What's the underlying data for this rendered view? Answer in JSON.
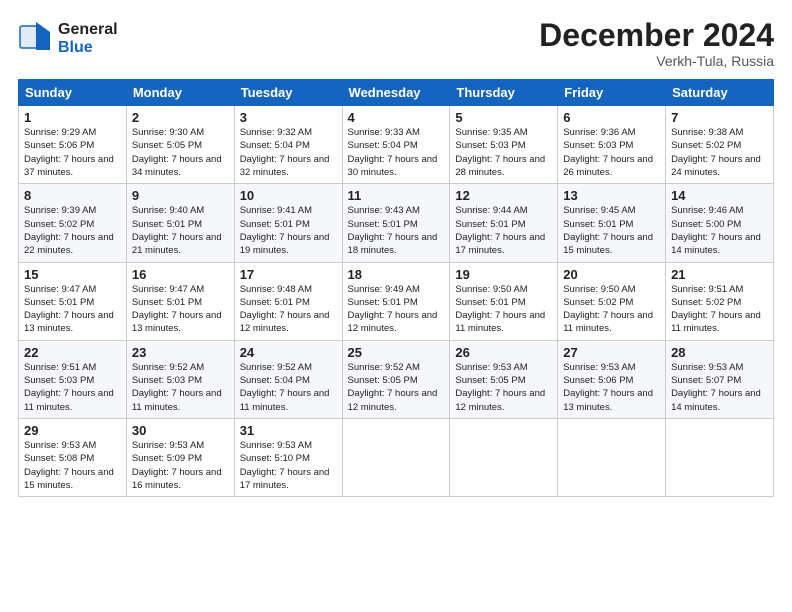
{
  "header": {
    "logo_line1": "General",
    "logo_line2": "Blue",
    "month_title": "December 2024",
    "location": "Verkh-Tula, Russia"
  },
  "days_of_week": [
    "Sunday",
    "Monday",
    "Tuesday",
    "Wednesday",
    "Thursday",
    "Friday",
    "Saturday"
  ],
  "weeks": [
    [
      {
        "day": "1",
        "sunrise": "9:29 AM",
        "sunset": "5:06 PM",
        "daylight": "7 hours and 37 minutes."
      },
      {
        "day": "2",
        "sunrise": "9:30 AM",
        "sunset": "5:05 PM",
        "daylight": "7 hours and 34 minutes."
      },
      {
        "day": "3",
        "sunrise": "9:32 AM",
        "sunset": "5:04 PM",
        "daylight": "7 hours and 32 minutes."
      },
      {
        "day": "4",
        "sunrise": "9:33 AM",
        "sunset": "5:04 PM",
        "daylight": "7 hours and 30 minutes."
      },
      {
        "day": "5",
        "sunrise": "9:35 AM",
        "sunset": "5:03 PM",
        "daylight": "7 hours and 28 minutes."
      },
      {
        "day": "6",
        "sunrise": "9:36 AM",
        "sunset": "5:03 PM",
        "daylight": "7 hours and 26 minutes."
      },
      {
        "day": "7",
        "sunrise": "9:38 AM",
        "sunset": "5:02 PM",
        "daylight": "7 hours and 24 minutes."
      }
    ],
    [
      {
        "day": "8",
        "sunrise": "9:39 AM",
        "sunset": "5:02 PM",
        "daylight": "7 hours and 22 minutes."
      },
      {
        "day": "9",
        "sunrise": "9:40 AM",
        "sunset": "5:01 PM",
        "daylight": "7 hours and 21 minutes."
      },
      {
        "day": "10",
        "sunrise": "9:41 AM",
        "sunset": "5:01 PM",
        "daylight": "7 hours and 19 minutes."
      },
      {
        "day": "11",
        "sunrise": "9:43 AM",
        "sunset": "5:01 PM",
        "daylight": "7 hours and 18 minutes."
      },
      {
        "day": "12",
        "sunrise": "9:44 AM",
        "sunset": "5:01 PM",
        "daylight": "7 hours and 17 minutes."
      },
      {
        "day": "13",
        "sunrise": "9:45 AM",
        "sunset": "5:01 PM",
        "daylight": "7 hours and 15 minutes."
      },
      {
        "day": "14",
        "sunrise": "9:46 AM",
        "sunset": "5:00 PM",
        "daylight": "7 hours and 14 minutes."
      }
    ],
    [
      {
        "day": "15",
        "sunrise": "9:47 AM",
        "sunset": "5:01 PM",
        "daylight": "7 hours and 13 minutes."
      },
      {
        "day": "16",
        "sunrise": "9:47 AM",
        "sunset": "5:01 PM",
        "daylight": "7 hours and 13 minutes."
      },
      {
        "day": "17",
        "sunrise": "9:48 AM",
        "sunset": "5:01 PM",
        "daylight": "7 hours and 12 minutes."
      },
      {
        "day": "18",
        "sunrise": "9:49 AM",
        "sunset": "5:01 PM",
        "daylight": "7 hours and 12 minutes."
      },
      {
        "day": "19",
        "sunrise": "9:50 AM",
        "sunset": "5:01 PM",
        "daylight": "7 hours and 11 minutes."
      },
      {
        "day": "20",
        "sunrise": "9:50 AM",
        "sunset": "5:02 PM",
        "daylight": "7 hours and 11 minutes."
      },
      {
        "day": "21",
        "sunrise": "9:51 AM",
        "sunset": "5:02 PM",
        "daylight": "7 hours and 11 minutes."
      }
    ],
    [
      {
        "day": "22",
        "sunrise": "9:51 AM",
        "sunset": "5:03 PM",
        "daylight": "7 hours and 11 minutes."
      },
      {
        "day": "23",
        "sunrise": "9:52 AM",
        "sunset": "5:03 PM",
        "daylight": "7 hours and 11 minutes."
      },
      {
        "day": "24",
        "sunrise": "9:52 AM",
        "sunset": "5:04 PM",
        "daylight": "7 hours and 11 minutes."
      },
      {
        "day": "25",
        "sunrise": "9:52 AM",
        "sunset": "5:05 PM",
        "daylight": "7 hours and 12 minutes."
      },
      {
        "day": "26",
        "sunrise": "9:53 AM",
        "sunset": "5:05 PM",
        "daylight": "7 hours and 12 minutes."
      },
      {
        "day": "27",
        "sunrise": "9:53 AM",
        "sunset": "5:06 PM",
        "daylight": "7 hours and 13 minutes."
      },
      {
        "day": "28",
        "sunrise": "9:53 AM",
        "sunset": "5:07 PM",
        "daylight": "7 hours and 14 minutes."
      }
    ],
    [
      {
        "day": "29",
        "sunrise": "9:53 AM",
        "sunset": "5:08 PM",
        "daylight": "7 hours and 15 minutes."
      },
      {
        "day": "30",
        "sunrise": "9:53 AM",
        "sunset": "5:09 PM",
        "daylight": "7 hours and 16 minutes."
      },
      {
        "day": "31",
        "sunrise": "9:53 AM",
        "sunset": "5:10 PM",
        "daylight": "7 hours and 17 minutes."
      },
      null,
      null,
      null,
      null
    ]
  ]
}
